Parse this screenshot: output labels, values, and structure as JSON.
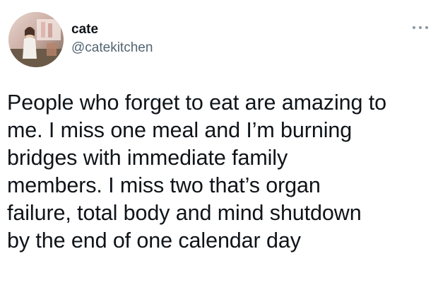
{
  "author": {
    "display_name": "cate",
    "handle": "@catekitchen"
  },
  "tweet": {
    "text": "People who forget to eat are amazing to\nme. I miss one meal and I’m burning\nbridges with immediate family\nmembers. I miss two that’s organ\nfailure, total body and mind shutdown\nby the end of one calendar day"
  },
  "icons": {
    "more": "more-options-icon",
    "avatar": "profile-photo"
  }
}
